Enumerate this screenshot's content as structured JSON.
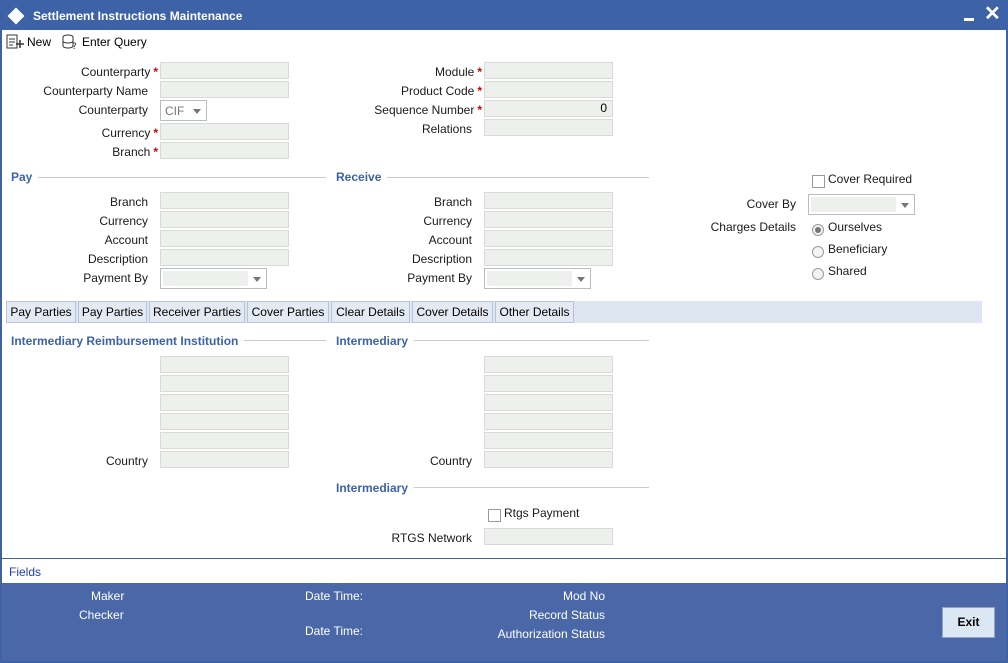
{
  "window": {
    "title": "Settlement Instructions Maintenance",
    "icon": "diamond-icon"
  },
  "toolbar": {
    "new_label": "New",
    "enter_query_label": "Enter Query"
  },
  "header": {
    "counterparty_label": "Counterparty",
    "counterparty_value": "",
    "counterparty_name_label": "Counterparty Name",
    "counterparty_name_value": "",
    "counterparty_type_label": "Counterparty",
    "counterparty_type_value": "CIF",
    "currency_label": "Currency",
    "currency_value": "",
    "branch_label": "Branch",
    "branch_value": "",
    "module_label": "Module",
    "module_value": "",
    "product_code_label": "Product Code",
    "product_code_value": "",
    "sequence_number_label": "Sequence Number",
    "sequence_number_value": "0",
    "relations_label": "Relations",
    "relations_value": "",
    "required_marker": "*"
  },
  "pay": {
    "section_title": "Pay",
    "branch_label": "Branch",
    "currency_label": "Currency",
    "account_label": "Account",
    "description_label": "Description",
    "payment_by_label": "Payment By",
    "payment_by_value": ""
  },
  "receive": {
    "section_title": "Receive",
    "branch_label": "Branch",
    "currency_label": "Currency",
    "account_label": "Account",
    "description_label": "Description",
    "payment_by_label": "Payment By",
    "payment_by_value": ""
  },
  "cover": {
    "cover_required_label": "Cover Required",
    "cover_required_checked": false,
    "cover_by_label": "Cover By",
    "cover_by_value": "",
    "charges_details_label": "Charges Details",
    "charges_options": [
      "Ourselves",
      "Beneficiary",
      "Shared"
    ],
    "charges_selected": "Ourselves"
  },
  "tabs": [
    "Pay Parties",
    "Pay Parties",
    "Receiver Parties",
    "Cover Parties",
    "Clear Details",
    "Cover Details",
    "Other Details"
  ],
  "tab_content": {
    "irb_title": "Intermediary Reimbursement Institution",
    "irb_country_label": "Country",
    "intermediary_title": "Intermediary",
    "intermediary_country_label": "Country",
    "intermediary2_title": "Intermediary",
    "rtgs_payment_label": "Rtgs Payment",
    "rtgs_network_label": "RTGS Network",
    "rtgs_network_value": ""
  },
  "fields_link": "Fields",
  "footer": {
    "maker_label": "Maker",
    "checker_label": "Checker",
    "date_time_label_1": "Date Time:",
    "date_time_label_2": "Date Time:",
    "mod_no_label": "Mod No",
    "record_status_label": "Record Status",
    "authorization_status_label": "Authorization Status",
    "exit_label": "Exit"
  },
  "colors": {
    "title_bar": "#3d62a6",
    "footer": "#4a68a8",
    "section_heading": "#3d62a6",
    "required_marker": "#d40000",
    "fields_link": "#2040c0"
  }
}
